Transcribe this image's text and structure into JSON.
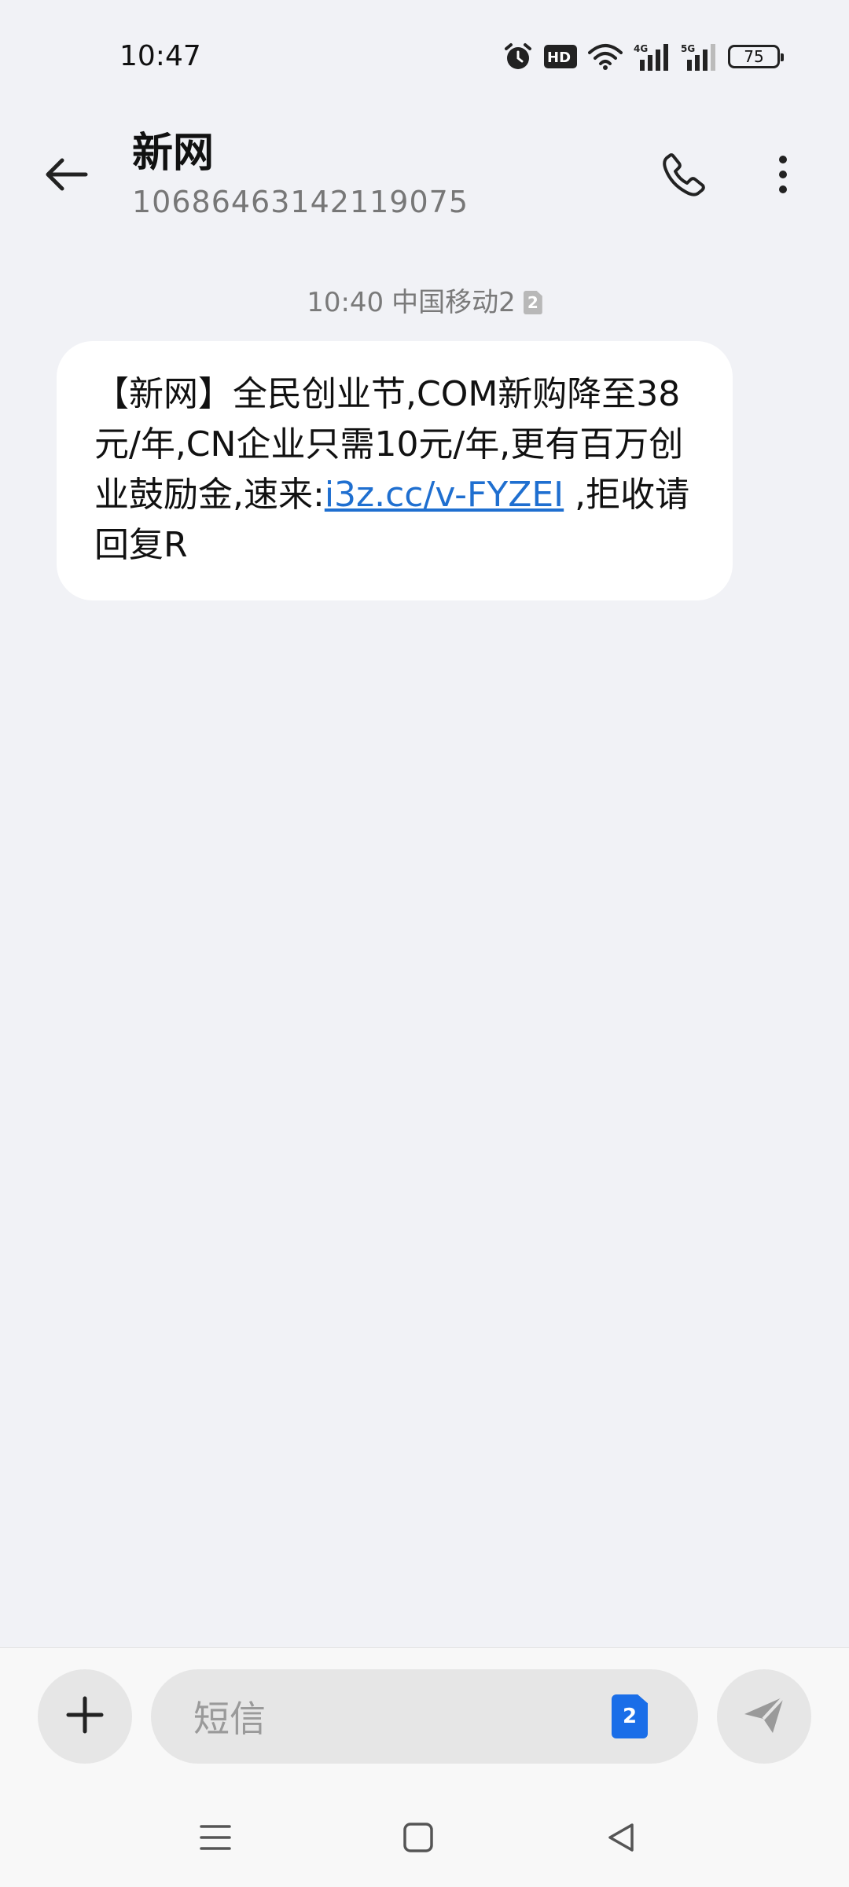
{
  "status_bar": {
    "time": "10:47",
    "icons": [
      "alarm-icon",
      "hd-icon",
      "wifi-icon",
      "signal-4g-icon",
      "signal-5g-icon"
    ],
    "hd_label": "HD",
    "net_4g_label": "4G",
    "net_5g_label": "5G",
    "battery": "75"
  },
  "header": {
    "contact_name": "新网",
    "contact_number": "10686463142119075",
    "back_icon": "back-arrow-icon",
    "call_icon": "phone-icon",
    "more_icon": "more-vertical-icon"
  },
  "message": {
    "time": "10:40",
    "carrier": "中国移动2",
    "sim_badge": "2",
    "text_before_link": "【新网】全民创业节,COM新购降至38元/年,CN企业只需10元/年,更有百万创业鼓励金,速来:",
    "link": "i3z.cc/v-FYZEI",
    "text_after_link": " ,拒收请回复R"
  },
  "input_bar": {
    "placeholder": "短信",
    "sim_select": "2",
    "add_icon": "plus-icon",
    "send_icon": "send-icon"
  },
  "nav_bar": {
    "icons": [
      "menu-icon",
      "home-icon",
      "back-triangle-icon"
    ]
  },
  "colors": {
    "background": "#f1f2f6",
    "bubble": "#ffffff",
    "link": "#1f6fd0",
    "sim_accent": "#1a6ee8"
  }
}
